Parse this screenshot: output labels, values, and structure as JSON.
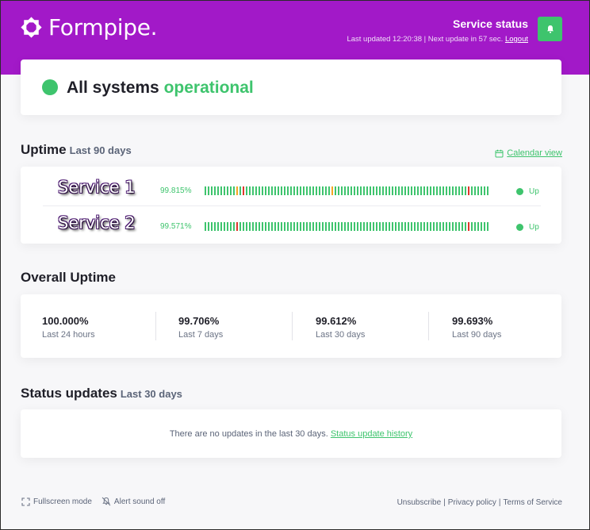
{
  "brand": {
    "name": "Formpipe.",
    "color": "#a219c8",
    "accent": "#3ec46d"
  },
  "header": {
    "title": "Service status",
    "last_updated": "Last updated 12:20:38 | Next update in 57 sec.",
    "logout": "Logout",
    "bell_icon": "bell-icon"
  },
  "status": {
    "prefix": "All systems",
    "state": "operational"
  },
  "uptime": {
    "title": "Uptime",
    "subtitle": "Last 90 days",
    "calendar_link": "Calendar view",
    "services": [
      {
        "name": "Service 1",
        "percent": "99.815%",
        "state": "Up",
        "bars": [
          "ok",
          "ok",
          "ok",
          "ok",
          "ok",
          "ok",
          "ok",
          "ok",
          "ok",
          "ok",
          "warn",
          "ok",
          "bad",
          "ok",
          "ok",
          "ok",
          "ok",
          "ok",
          "ok",
          "ok",
          "ok",
          "ok",
          "ok",
          "ok",
          "ok",
          "ok",
          "ok",
          "ok",
          "ok",
          "ok",
          "ok",
          "ok",
          "ok",
          "ok",
          "ok",
          "ok",
          "ok",
          "ok",
          "ok",
          "ok",
          "warn",
          "ok",
          "ok",
          "ok",
          "ok",
          "ok",
          "ok",
          "ok",
          "ok",
          "ok",
          "ok",
          "ok",
          "ok",
          "ok",
          "ok",
          "ok",
          "ok",
          "ok",
          "ok",
          "ok",
          "ok",
          "ok",
          "ok",
          "ok",
          "ok",
          "ok",
          "ok",
          "ok",
          "ok",
          "ok",
          "ok",
          "ok",
          "ok",
          "ok",
          "ok",
          "ok",
          "ok",
          "ok",
          "ok",
          "ok",
          "ok",
          "ok",
          "ok",
          "bad",
          "ok",
          "ok",
          "ok",
          "ok",
          "ok",
          "ok"
        ]
      },
      {
        "name": "Service 2",
        "percent": "99.571%",
        "state": "Up",
        "bars": [
          "ok",
          "ok",
          "ok",
          "ok",
          "ok",
          "ok",
          "ok",
          "ok",
          "ok",
          "ok",
          "bad",
          "ok",
          "ok",
          "ok",
          "ok",
          "ok",
          "ok",
          "ok",
          "ok",
          "ok",
          "ok",
          "ok",
          "ok",
          "ok",
          "ok",
          "ok",
          "ok",
          "ok",
          "ok",
          "ok",
          "ok",
          "ok",
          "ok",
          "ok",
          "ok",
          "ok",
          "ok",
          "ok",
          "ok",
          "ok",
          "ok",
          "ok",
          "ok",
          "ok",
          "ok",
          "ok",
          "ok",
          "ok",
          "ok",
          "ok",
          "ok",
          "ok",
          "ok",
          "ok",
          "ok",
          "ok",
          "ok",
          "ok",
          "ok",
          "ok",
          "ok",
          "ok",
          "ok",
          "ok",
          "ok",
          "ok",
          "ok",
          "ok",
          "ok",
          "ok",
          "ok",
          "ok",
          "ok",
          "ok",
          "ok",
          "ok",
          "ok",
          "ok",
          "ok",
          "ok",
          "ok",
          "ok",
          "ok",
          "bad",
          "ok",
          "ok",
          "ok",
          "ok",
          "ok",
          "ok"
        ]
      }
    ]
  },
  "overall": {
    "title": "Overall Uptime",
    "stats": [
      {
        "value": "100.000%",
        "label": "Last 24 hours"
      },
      {
        "value": "99.706%",
        "label": "Last 7 days"
      },
      {
        "value": "99.612%",
        "label": "Last 30 days"
      },
      {
        "value": "99.693%",
        "label": "Last 90 days"
      }
    ]
  },
  "updates": {
    "title": "Status updates",
    "subtitle": "Last 30 days",
    "message": "There are no updates in the last 30 days.",
    "history_link": "Status update history"
  },
  "footer": {
    "fullscreen": "Fullscreen mode",
    "alert": "Alert sound off",
    "links": [
      "Unsubscribe",
      "Privacy policy",
      "Terms of Service"
    ]
  }
}
